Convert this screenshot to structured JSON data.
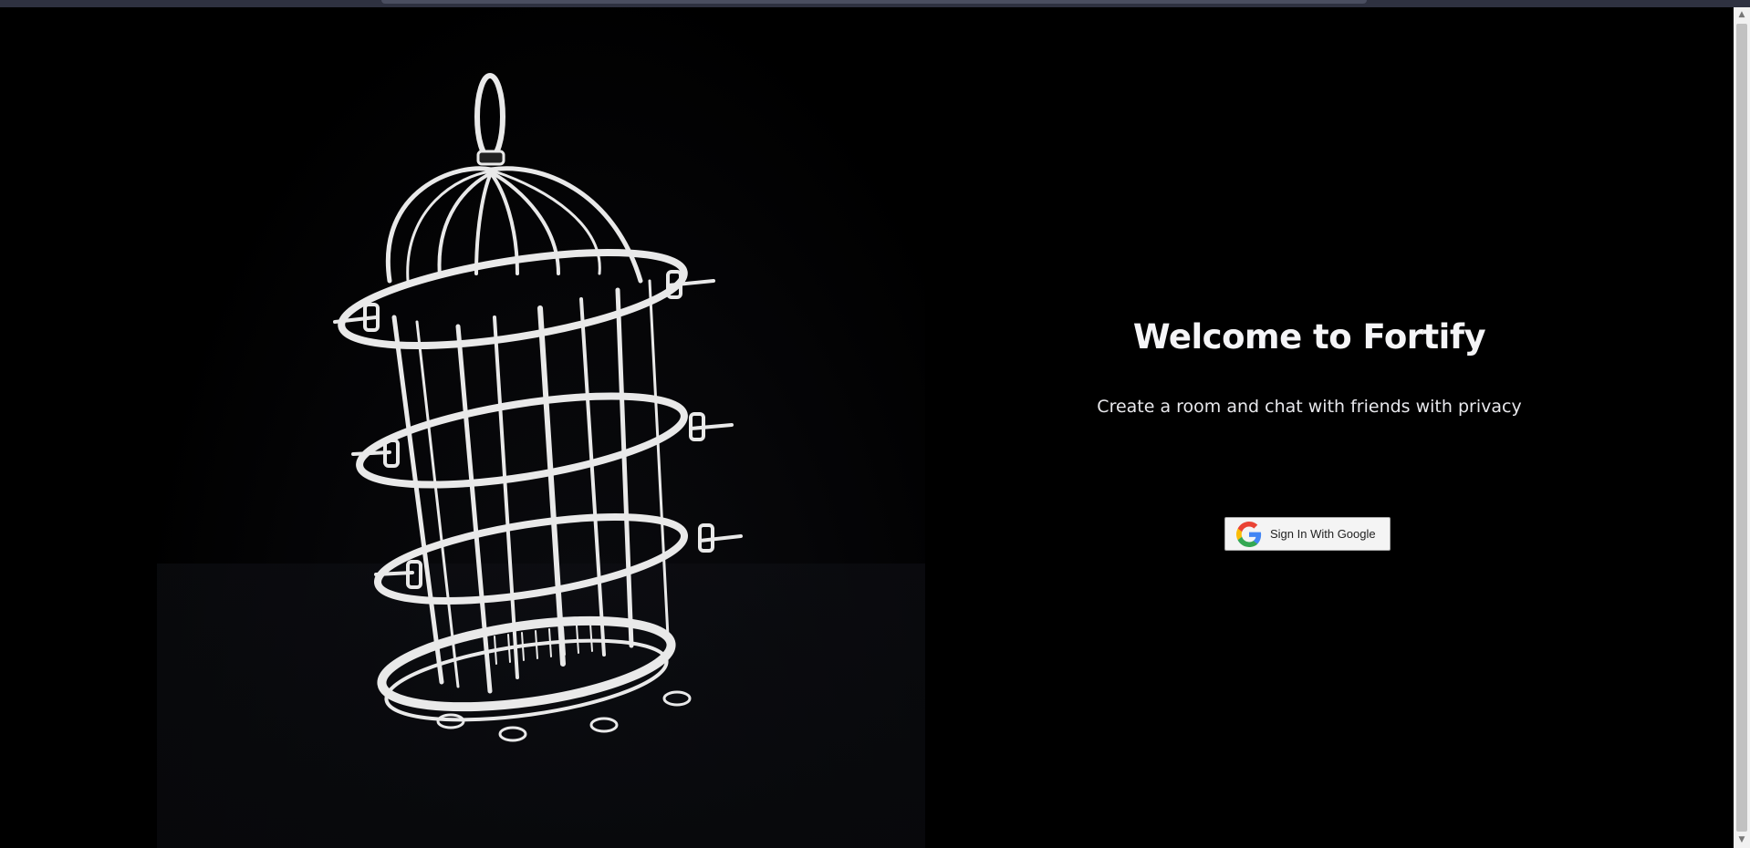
{
  "hero": {
    "title": "Welcome to Fortify",
    "subtitle": "Create a room and chat with friends with privacy"
  },
  "signin": {
    "label": "Sign In With Google",
    "icon": "google-g-icon"
  },
  "scene": {
    "illustration": "birdcage-3d-icon"
  },
  "scrollbar": {
    "up_icon": "scroll-up-arrow-icon",
    "down_icon": "scroll-down-arrow-icon"
  },
  "colors": {
    "background": "#000000",
    "text": "#f5f5f7",
    "button_bg": "#f4f4f4",
    "google_blue": "#4285F4",
    "google_red": "#EA4335",
    "google_yellow": "#FBBC05",
    "google_green": "#34A853"
  }
}
